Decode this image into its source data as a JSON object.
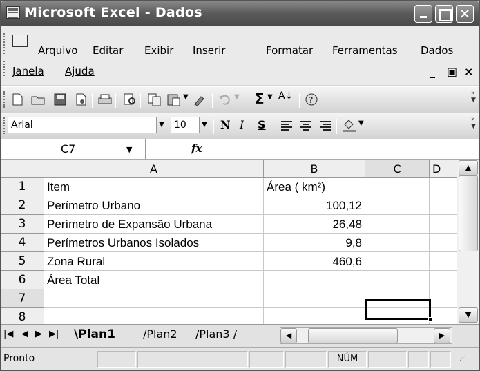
{
  "window": {
    "title": "Microsoft Excel - Dados"
  },
  "menu": {
    "items": [
      "Arquivo",
      "Editar",
      "Exibir",
      "Inserir",
      "Formatar",
      "Ferramentas",
      "Dados",
      "Janela",
      "Ajuda"
    ]
  },
  "toolbar2": {
    "font": "Arial",
    "size": "10",
    "bold": "N",
    "italic": "I",
    "underline": "S"
  },
  "formula": {
    "cell_ref": "C7",
    "fx": "fx",
    "value": ""
  },
  "columns": [
    "A",
    "B",
    "C",
    "D"
  ],
  "rows": [
    {
      "num": "1",
      "a": "Item",
      "b": "Área ( km²)"
    },
    {
      "num": "2",
      "a": "Perímetro Urbano",
      "b": "100,12"
    },
    {
      "num": "3",
      "a": "Perímetro de Expansão Urbana",
      "b": "26,48"
    },
    {
      "num": "4",
      "a": "Perímetros Urbanos Isolados",
      "b": "9,8"
    },
    {
      "num": "5",
      "a": "Zona Rural",
      "b": "460,6"
    },
    {
      "num": "6",
      "a": "Área Total",
      "b": ""
    },
    {
      "num": "7",
      "a": "",
      "b": ""
    },
    {
      "num": "8",
      "a": "",
      "b": ""
    }
  ],
  "sheets": [
    "Plan1",
    "Plan2",
    "Plan3"
  ],
  "status": {
    "text": "Pronto",
    "num": "NÚM"
  }
}
